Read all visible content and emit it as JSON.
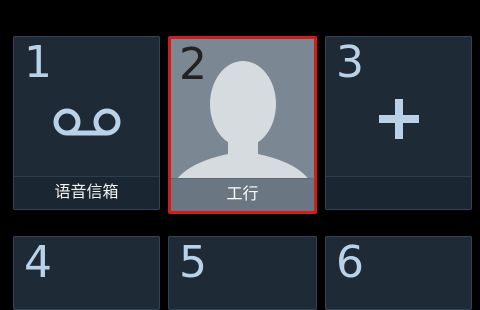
{
  "speed_dial": {
    "tiles": [
      {
        "number": "1",
        "label": "语音信箱",
        "icon": "voicemail-icon"
      },
      {
        "number": "2",
        "label": "工行",
        "icon": "contact-avatar-icon",
        "selected": true
      },
      {
        "number": "3",
        "label": "",
        "icon": "plus-icon"
      },
      {
        "number": "4"
      },
      {
        "number": "5"
      },
      {
        "number": "6"
      }
    ]
  },
  "colors": {
    "tile_bg": "#1e2b37",
    "digit": "#b9d2e8",
    "selected_border": "#d21c1c",
    "avatar_bg": "#7b8792"
  }
}
